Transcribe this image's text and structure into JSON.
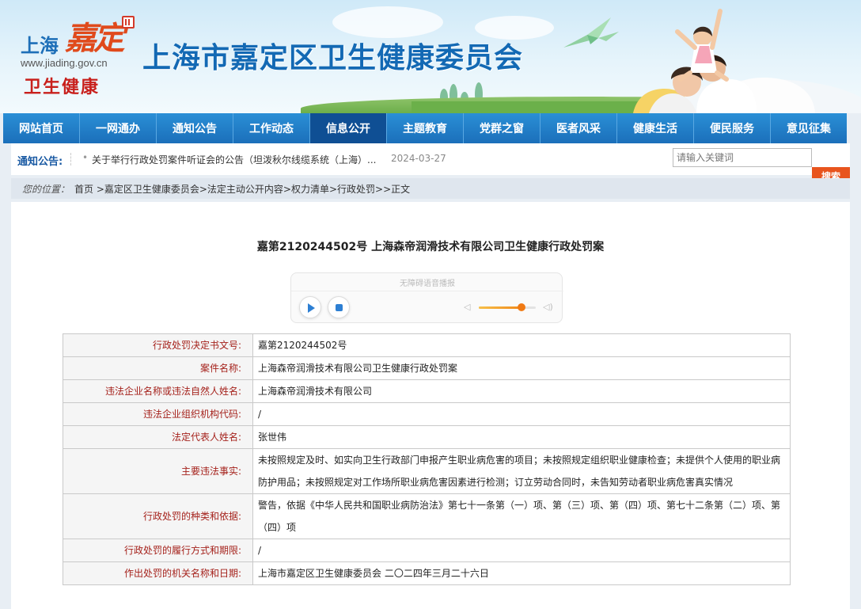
{
  "header": {
    "logo_city": "上海",
    "logo_district": "嘉定",
    "logo_url": "www.jiading.gov.cn",
    "logo_health": "卫生健康",
    "site_title": "上海市嘉定区卫生健康委员会"
  },
  "nav": {
    "items": [
      "网站首页",
      "一网通办",
      "通知公告",
      "工作动态",
      "信息公开",
      "主题教育",
      "党群之窗",
      "医者风采",
      "健康生活",
      "便民服务",
      "意见征集"
    ],
    "active": "信息公开"
  },
  "notice": {
    "label": "通知公告:",
    "bullet": "•",
    "text": "关于举行行政处罚案件听证会的公告（坦泼秋尔线缆系统（上海）...",
    "date": "2024-03-27"
  },
  "search": {
    "placeholder": "请输入关键词",
    "button_label": "搜索"
  },
  "breadcrumb": {
    "label": "您的位置：",
    "path": "首页 >嘉定区卫生健康委员会>法定主动公开内容>权力清单>行政处罚>>正文"
  },
  "document": {
    "title": "嘉第2120244502号  上海森帝润滑技术有限公司卫生健康行政处罚案"
  },
  "audio_player": {
    "label": "无障碍语音播报",
    "volume": 0.75
  },
  "info_table": [
    {
      "key": "行政处罚决定书文号:",
      "value": "嘉第2120244502号"
    },
    {
      "key": "案件名称:",
      "value": "上海森帝润滑技术有限公司卫生健康行政处罚案"
    },
    {
      "key": "违法企业名称或违法自然人姓名:",
      "value": "上海森帝润滑技术有限公司"
    },
    {
      "key": "违法企业组织机构代码:",
      "value": "/"
    },
    {
      "key": "法定代表人姓名:",
      "value": "张世伟"
    },
    {
      "key": "主要违法事实:",
      "value": "未按照规定及时、如实向卫生行政部门申报产生职业病危害的项目；未按照规定组织职业健康检查；未提供个人使用的职业病防护用品；未按照规定对工作场所职业病危害因素进行检测；订立劳动合同时，未告知劳动者职业病危害真实情况"
    },
    {
      "key": "行政处罚的种类和依据:",
      "value": "警告，依据《中华人民共和国职业病防治法》第七十一条第（一）项、第（三）项、第（四）项、第七十二条第（二）项、第（四）项"
    },
    {
      "key": "行政处罚的履行方式和期限:",
      "value": "/"
    },
    {
      "key": "作出处罚的机关名称和日期:",
      "value": "上海市嘉定区卫生健康委员会  二〇二四年三月二十六日"
    }
  ]
}
